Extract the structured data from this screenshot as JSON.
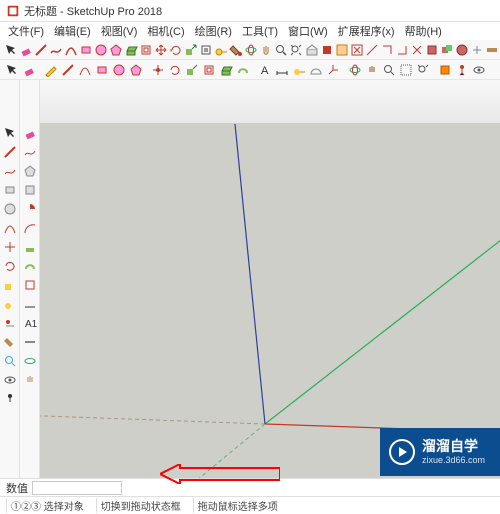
{
  "title": "无标题 - SketchUp Pro 2018",
  "menu": {
    "items": [
      {
        "label": "文件(F)"
      },
      {
        "label": "编辑(E)"
      },
      {
        "label": "视图(V)"
      },
      {
        "label": "相机(C)"
      },
      {
        "label": "绘图(R)"
      },
      {
        "label": "工具(T)"
      },
      {
        "label": "窗口(W)"
      },
      {
        "label": "扩展程序(x)"
      },
      {
        "label": "帮助(H)"
      }
    ]
  },
  "status": {
    "label": "数值",
    "hint1": "①②③ 选择对象",
    "hint2": "切换到拖动状态框",
    "hint3": "拖动鼠标选择多项"
  },
  "watermark": {
    "brand": "溜溜自学",
    "url": "zixue.3d66.com"
  },
  "axes": {
    "red": "#c0392b",
    "green": "#27ae60",
    "blue": "#2c3e9e"
  }
}
